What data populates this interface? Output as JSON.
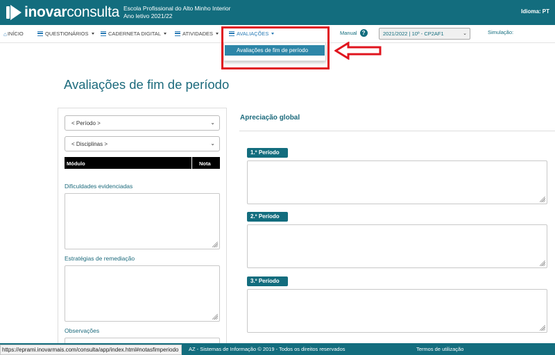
{
  "header": {
    "logo_bold": "inovar",
    "logo_light": "consulta",
    "school_name": "Escola Profissional do Alto Minho Interior",
    "school_year": "Ano letivo 2021/22",
    "language": "Idioma: PT"
  },
  "nav": {
    "home": "INÍCIO",
    "questionnaires": "QUESTIONÁRIOS",
    "digital_notebook": "CADERNETA DIGITAL",
    "activities": "ATIVIDADES",
    "assessments": "AVALIAÇÕES",
    "manual": "Manual",
    "class_selector": "2021/2022 | 10º - CP2AF1",
    "simulation": "Simulação:"
  },
  "dropdown": {
    "items": [
      "Avaliações de fim de período"
    ]
  },
  "main": {
    "page_title": "Avaliações de fim de período",
    "period_select": "< Período >",
    "subjects_select": "< Disciplinas >",
    "table_headers": [
      "Módulo",
      "Nota"
    ],
    "difficulties_label": "Dificuldades evidenciadas",
    "remediation_label": "Estratégias de remediação",
    "observations_label": "Observações",
    "global_title": "Apreciação global",
    "periods": [
      "1.º Período",
      "2.º Período",
      "3.º Período"
    ]
  },
  "footer": {
    "copyright": "AZ - Sistemas de Informação © 2019 - Todos os direitos reservados",
    "terms": "Termos de utilização",
    "status_url": "https://eprami.inovarmais.com/consulta/app/index.html#notasfimperiodo"
  },
  "colors": {
    "brand_teal": "#136d7e",
    "link_blue": "#2a7bb6",
    "annotation_red": "#e0141e"
  }
}
